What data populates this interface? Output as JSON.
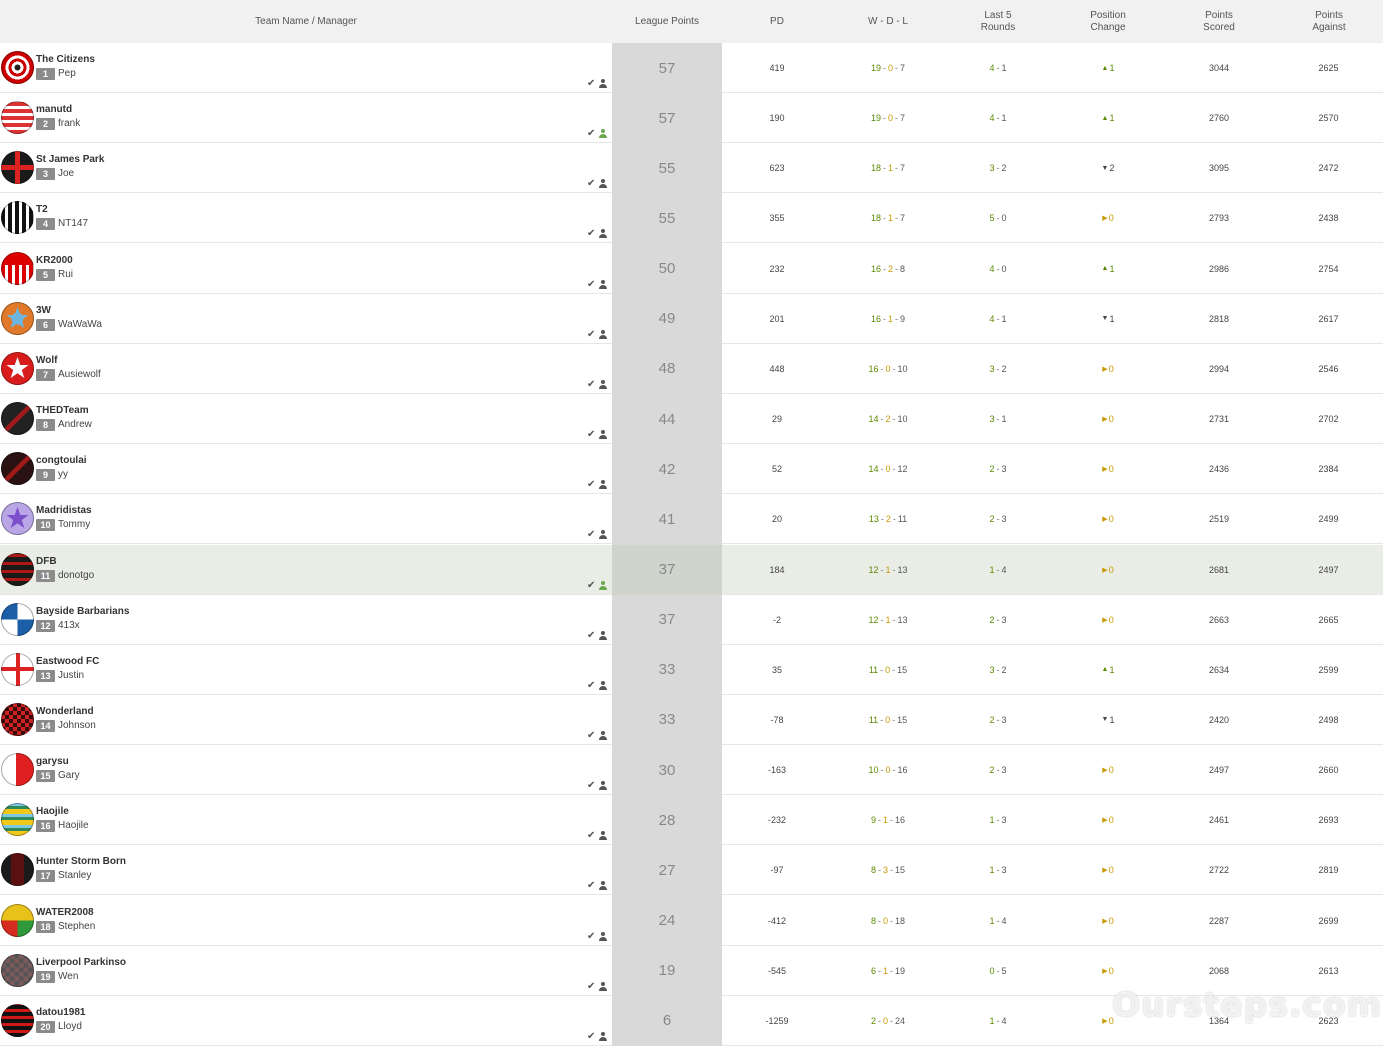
{
  "headers": {
    "team": "Team Name / Manager",
    "league_points": "League Points",
    "pd": "PD",
    "wdl": "W - D - L",
    "last5": "Last 5 Rounds",
    "position_change": "Position Change",
    "points_scored": "Points Scored",
    "points_against": "Points Against"
  },
  "highlight_rank": "11",
  "watermark": "Oursteps.com.au",
  "rows": [
    {
      "team": "The Citizens",
      "rank": "1",
      "manager": "Pep",
      "pts": "57",
      "pd": "419",
      "w": "19",
      "d": "0",
      "l": "7",
      "l5w": "4",
      "l5l": "1",
      "dir": "up",
      "change": "1",
      "ps": "3044",
      "pa": "2625",
      "jersey": "target",
      "user_status": "default"
    },
    {
      "team": "manutd",
      "rank": "2",
      "manager": "frank",
      "pts": "57",
      "pd": "190",
      "w": "19",
      "d": "0",
      "l": "7",
      "l5w": "4",
      "l5l": "1",
      "dir": "up",
      "change": "1",
      "ps": "2760",
      "pa": "2570",
      "jersey": "hstripes-red",
      "user_status": "active"
    },
    {
      "team": "St James Park",
      "rank": "3",
      "manager": "Joe",
      "pts": "55",
      "pd": "623",
      "w": "18",
      "d": "1",
      "l": "7",
      "l5w": "3",
      "l5l": "2",
      "dir": "down",
      "change": "2",
      "ps": "3095",
      "pa": "2472",
      "jersey": "cross-black",
      "user_status": "default"
    },
    {
      "team": "T2",
      "rank": "4",
      "manager": "NT147",
      "pts": "55",
      "pd": "355",
      "w": "18",
      "d": "1",
      "l": "7",
      "l5w": "5",
      "l5l": "0",
      "dir": "same",
      "change": "0",
      "ps": "2793",
      "pa": "2438",
      "jersey": "vstripes-bw",
      "user_status": "default"
    },
    {
      "team": "KR2000",
      "rank": "5",
      "manager": "Rui",
      "pts": "50",
      "pd": "232",
      "w": "16",
      "d": "2",
      "l": "8",
      "l5w": "4",
      "l5l": "0",
      "dir": "up",
      "change": "1",
      "ps": "2986",
      "pa": "2754",
      "jersey": "vstripes-red",
      "user_status": "default"
    },
    {
      "team": "3W",
      "rank": "6",
      "manager": "WaWaWa",
      "pts": "49",
      "pd": "201",
      "w": "16",
      "d": "1",
      "l": "9",
      "l5w": "4",
      "l5l": "1",
      "dir": "down",
      "change": "1",
      "ps": "2818",
      "pa": "2617",
      "jersey": "star-orange",
      "user_status": "default"
    },
    {
      "team": "Wolf",
      "rank": "7",
      "manager": "Ausiewolf",
      "pts": "48",
      "pd": "448",
      "w": "16",
      "d": "0",
      "l": "10",
      "l5w": "3",
      "l5l": "2",
      "dir": "same",
      "change": "0",
      "ps": "2994",
      "pa": "2546",
      "jersey": "star-red",
      "user_status": "default"
    },
    {
      "team": "THEDTeam",
      "rank": "8",
      "manager": "Andrew",
      "pts": "44",
      "pd": "29",
      "w": "14",
      "d": "2",
      "l": "10",
      "l5w": "3",
      "l5l": "1",
      "dir": "same",
      "change": "0",
      "ps": "2731",
      "pa": "2702",
      "jersey": "chevron-dark",
      "user_status": "default"
    },
    {
      "team": "congtoulai",
      "rank": "9",
      "manager": "yy",
      "pts": "42",
      "pd": "52",
      "w": "14",
      "d": "0",
      "l": "12",
      "l5w": "2",
      "l5l": "3",
      "dir": "same",
      "change": "0",
      "ps": "2436",
      "pa": "2384",
      "jersey": "chevron-darkred",
      "user_status": "default"
    },
    {
      "team": "Madridistas",
      "rank": "10",
      "manager": "Tommy",
      "pts": "41",
      "pd": "20",
      "w": "13",
      "d": "2",
      "l": "11",
      "l5w": "2",
      "l5l": "3",
      "dir": "same",
      "change": "0",
      "ps": "2519",
      "pa": "2499",
      "jersey": "star-purple",
      "user_status": "default"
    },
    {
      "team": "DFB",
      "rank": "11",
      "manager": "donotgo",
      "pts": "37",
      "pd": "184",
      "w": "12",
      "d": "1",
      "l": "13",
      "l5w": "1",
      "l5l": "4",
      "dir": "same",
      "change": "0",
      "ps": "2681",
      "pa": "2497",
      "jersey": "hstripes-dark",
      "user_status": "active"
    },
    {
      "team": "Bayside Barbarians",
      "rank": "12",
      "manager": "413x",
      "pts": "37",
      "pd": "-2",
      "w": "12",
      "d": "1",
      "l": "13",
      "l5w": "2",
      "l5l": "3",
      "dir": "same",
      "change": "0",
      "ps": "2663",
      "pa": "2665",
      "jersey": "quarters-blue",
      "user_status": "default"
    },
    {
      "team": "Eastwood FC",
      "rank": "13",
      "manager": "Justin",
      "pts": "33",
      "pd": "35",
      "w": "11",
      "d": "0",
      "l": "15",
      "l5w": "3",
      "l5l": "2",
      "dir": "up",
      "change": "1",
      "ps": "2634",
      "pa": "2599",
      "jersey": "cross-white",
      "user_status": "default"
    },
    {
      "team": "Wonderland",
      "rank": "14",
      "manager": "Johnson",
      "pts": "33",
      "pd": "-78",
      "w": "11",
      "d": "0",
      "l": "15",
      "l5w": "2",
      "l5l": "3",
      "dir": "down",
      "change": "1",
      "ps": "2420",
      "pa": "2498",
      "jersey": "checker-red",
      "user_status": "default"
    },
    {
      "team": "garysu",
      "rank": "15",
      "manager": "Gary",
      "pts": "30",
      "pd": "-163",
      "w": "10",
      "d": "0",
      "l": "16",
      "l5w": "2",
      "l5l": "3",
      "dir": "same",
      "change": "0",
      "ps": "2497",
      "pa": "2660",
      "jersey": "half-red",
      "user_status": "default"
    },
    {
      "team": "Haojile",
      "rank": "16",
      "manager": "Haojile",
      "pts": "28",
      "pd": "-232",
      "w": "9",
      "d": "1",
      "l": "16",
      "l5w": "1",
      "l5l": "3",
      "dir": "same",
      "change": "0",
      "ps": "2461",
      "pa": "2693",
      "jersey": "hstripes-yellow",
      "user_status": "default"
    },
    {
      "team": "Hunter Storm Born",
      "rank": "17",
      "manager": "Stanley",
      "pts": "27",
      "pd": "-97",
      "w": "8",
      "d": "3",
      "l": "15",
      "l5w": "1",
      "l5l": "3",
      "dir": "same",
      "change": "0",
      "ps": "2722",
      "pa": "2819",
      "jersey": "dark-maroon",
      "user_status": "default"
    },
    {
      "team": "WATER2008",
      "rank": "18",
      "manager": "Stephen",
      "pts": "24",
      "pd": "-412",
      "w": "8",
      "d": "0",
      "l": "18",
      "l5w": "1",
      "l5l": "4",
      "dir": "same",
      "change": "0",
      "ps": "2287",
      "pa": "2699",
      "jersey": "quarters-green",
      "user_status": "default"
    },
    {
      "team": "Liverpool Parkinso",
      "rank": "19",
      "manager": "Wen",
      "pts": "19",
      "pd": "-545",
      "w": "6",
      "d": "1",
      "l": "19",
      "l5w": "0",
      "l5l": "5",
      "dir": "same",
      "change": "0",
      "ps": "2068",
      "pa": "2613",
      "jersey": "checker-grey",
      "user_status": "default"
    },
    {
      "team": "datou1981",
      "rank": "20",
      "manager": "Lloyd",
      "pts": "6",
      "pd": "-1259",
      "w": "2",
      "d": "0",
      "l": "24",
      "l5w": "1",
      "l5l": "4",
      "dir": "same",
      "change": "0",
      "ps": "1364",
      "pa": "2623",
      "jersey": "hstripes-black-red",
      "user_status": "default"
    }
  ]
}
